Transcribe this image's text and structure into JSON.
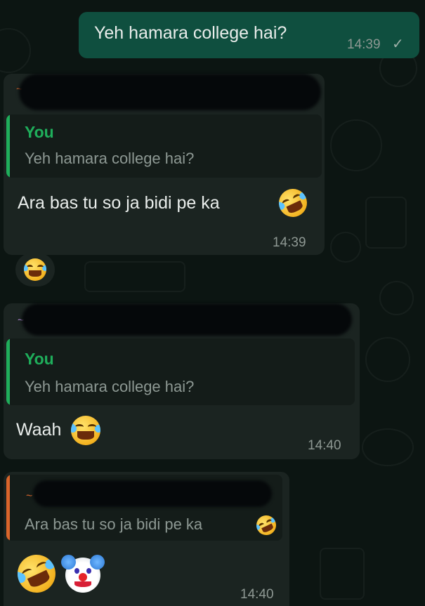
{
  "messages": {
    "sent": {
      "text": "Yeh hamara college hai?",
      "time": "14:39",
      "status_icon": "single-check-icon"
    },
    "reply1": {
      "sender_mark": "~",
      "quote_author": "You",
      "quote_text": "Yeh hamara college hai?",
      "text": "Ara bas tu so ja bidi pe ka",
      "emoji": "rolling-on-floor-laughing-emoji",
      "time": "14:39"
    },
    "reaction": {
      "emoji": "face-with-tears-of-joy-emoji"
    },
    "reply2": {
      "sender_mark": "~",
      "quote_author": "You",
      "quote_text": "Yeh hamara college hai?",
      "text": "Waah",
      "emoji": "face-with-tears-of-joy-emoji",
      "time": "14:40"
    },
    "reply3": {
      "sender_mark": "~",
      "quote_text": "Ara bas tu so ja bidi pe ka",
      "quote_emoji": "rolling-on-floor-laughing-emoji",
      "emojis": [
        "rolling-on-floor-laughing-emoji",
        "clown-face-emoji"
      ],
      "time": "14:40"
    }
  },
  "colors": {
    "background": "#0c1512",
    "outgoing_bubble": "#0f4f3f",
    "incoming_bubble": "#1b2421",
    "quote_bar_self": "#1fae5b",
    "quote_bar_other": "#d9652b",
    "quote_author": "#1fae5b",
    "sender_mark_1": "#d9652b",
    "sender_mark_2": "#b48ad8",
    "sender_mark_3": "#d9652b"
  }
}
